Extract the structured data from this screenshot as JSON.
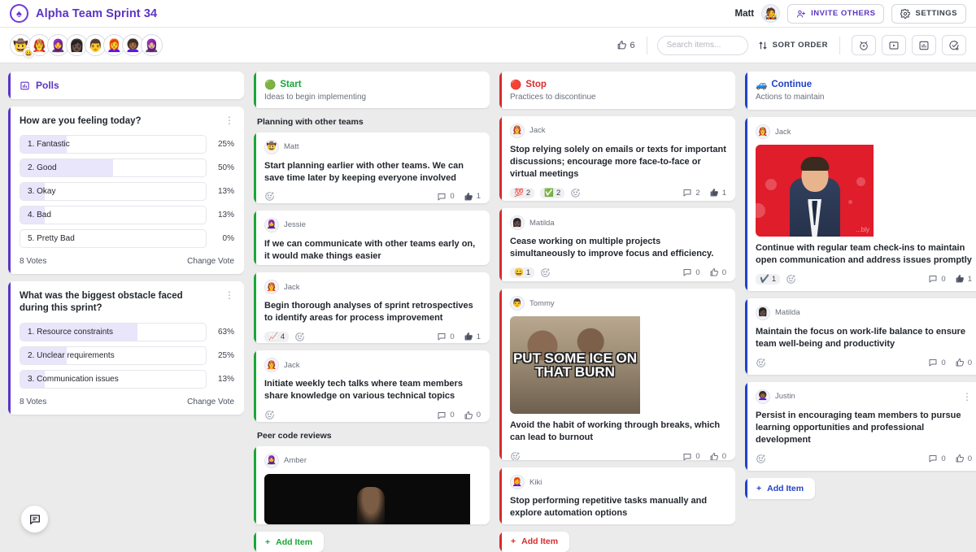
{
  "header": {
    "brand_title": "Alpha Team Sprint 34",
    "logo_icon": "spade-logo-icon",
    "user_name": "Matt",
    "user_avatar": "🧑‍🎤",
    "invite_label": "INVITE OTHERS",
    "settings_label": "SETTINGS"
  },
  "toolbar": {
    "participants": [
      "🤠",
      "👩‍🚒",
      "🧕",
      "👩🏿",
      "👨",
      "👩‍🦰",
      "👩🏾‍🦱",
      "🧕🏼"
    ],
    "participant_badge": "😀",
    "votes_count": "6",
    "search_placeholder": "Search items...",
    "search_value": "",
    "sort_label": "SORT ORDER",
    "icon_buttons": [
      "timer-icon",
      "present-icon",
      "poll-chart-icon",
      "checklist-icon"
    ]
  },
  "polls": {
    "panel_title": "Polls",
    "panel_icon": "poll-chart-icon",
    "accent": "#5b34c4",
    "items": [
      {
        "question": "How are you feeling today?",
        "options": [
          {
            "label": "1. Fantastic",
            "pct": "25%",
            "value": 25
          },
          {
            "label": "2. Good",
            "pct": "50%",
            "value": 50
          },
          {
            "label": "3. Okay",
            "pct": "13%",
            "value": 13
          },
          {
            "label": "4. Bad",
            "pct": "13%",
            "value": 13
          },
          {
            "label": "5. Pretty Bad",
            "pct": "0%",
            "value": 0
          }
        ],
        "votes": "8 Votes",
        "change_vote": "Change Vote"
      },
      {
        "question": "What was the biggest obstacle faced during this sprint?",
        "options": [
          {
            "label": "1. Resource constraints",
            "pct": "63%",
            "value": 63
          },
          {
            "label": "2. Unclear requirements",
            "pct": "25%",
            "value": 25
          },
          {
            "label": "3. Communication issues",
            "pct": "13%",
            "value": 13
          }
        ],
        "votes": "8 Votes",
        "change_vote": "Change Vote"
      }
    ]
  },
  "columns": [
    {
      "id": "start",
      "title": "Start",
      "emoji": "🟢",
      "subtitle": "Ideas to begin implementing",
      "color": "#1aa637",
      "add_label": "Add Item",
      "groups": [
        {
          "label": "Planning with other teams",
          "cards": [
            {
              "author": "Matt",
              "avatar": "🤠",
              "text": "Start planning earlier with other teams. We can save time later by keeping everyone involved",
              "reactions": [],
              "comments": "0",
              "likes": "1",
              "liked": true
            },
            {
              "author": "Jessie",
              "avatar": "🧕",
              "text": "If we can communicate with other teams early on, it would make things easier",
              "reactions": [],
              "comments": "",
              "likes": "",
              "liked": false
            },
            {
              "author": "Jack",
              "avatar": "👩‍🚒",
              "text": " Begin thorough analyses of sprint retrospectives to identify areas for process improvement",
              "reactions": [
                {
                  "emoji": "📈",
                  "count": "4"
                }
              ],
              "comments": "0",
              "likes": "1",
              "liked": true
            },
            {
              "author": "Jack",
              "avatar": "👩‍🚒",
              "text": "Initiate weekly tech talks where team members share knowledge on various technical topics",
              "reactions": [],
              "comments": "0",
              "likes": "0",
              "liked": false
            }
          ]
        },
        {
          "label": "Peer code reviews",
          "cards": [
            {
              "author": "Amber",
              "avatar": "🧕",
              "text": "",
              "media": "dark-photo",
              "reactions": [],
              "comments": "",
              "likes": "",
              "liked": false
            }
          ]
        }
      ]
    },
    {
      "id": "stop",
      "title": "Stop",
      "emoji": "🔴",
      "subtitle": "Practices to discontinue",
      "color": "#d92b2b",
      "add_label": "Add Item",
      "groups": [
        {
          "label": "",
          "cards": [
            {
              "author": "Jack",
              "avatar": "👩‍🚒",
              "text": "Stop relying solely on emails or texts for important discussions; encourage more face-to-face or virtual meetings",
              "reactions": [
                {
                  "emoji": "💯",
                  "count": "2"
                },
                {
                  "emoji": "✅",
                  "count": "2"
                }
              ],
              "comments": "2",
              "likes": "1",
              "liked": true
            },
            {
              "author": "Matilda",
              "avatar": "👩🏿",
              "text": "Cease working on multiple projects simultaneously to improve focus and efficiency.",
              "reactions": [
                {
                  "emoji": "😄",
                  "count": "1"
                }
              ],
              "comments": "0",
              "likes": "0",
              "liked": false
            },
            {
              "author": "Tommy",
              "avatar": "👨",
              "text": "Avoid the habit of working through breaks, which can lead to burnout",
              "media": "meme-ice",
              "media_text": "PUT SOME ICE ON THAT BURN",
              "reactions": [],
              "comments": "0",
              "likes": "0",
              "liked": false
            },
            {
              "author": "Kiki",
              "avatar": "👩‍🦰",
              "text": "Stop performing repetitive tasks manually and explore automation options",
              "reactions": [],
              "comments": "",
              "likes": "",
              "liked": false
            }
          ]
        }
      ]
    },
    {
      "id": "continue",
      "title": "Continue",
      "emoji": "🚙",
      "subtitle": "Actions to maintain",
      "color": "#2242c7",
      "add_label": "Add Item",
      "groups": [
        {
          "label": "",
          "cards": [
            {
              "author": "Jack",
              "avatar": "👩‍🚒",
              "text": "Continue with regular team check-ins to maintain open communication and address issues promptly",
              "media": "gif-red",
              "media_watermark": "...bly",
              "reactions": [
                {
                  "emoji": "✔️",
                  "count": "1"
                }
              ],
              "comments": "0",
              "likes": "1",
              "liked": true
            },
            {
              "author": "Matilda",
              "avatar": "👩🏿",
              "text": "Maintain the focus on work-life balance to ensure team well-being and productivity",
              "reactions": [],
              "comments": "0",
              "likes": "0",
              "liked": false
            },
            {
              "author": "Justin",
              "avatar": "👩🏾‍🦱",
              "text": "Persist in encouraging team members to pursue learning opportunities and professional development",
              "kebab": true,
              "reactions": [],
              "comments": "0",
              "likes": "0",
              "liked": false
            }
          ]
        }
      ]
    }
  ],
  "fab": {
    "icon": "chat-icon"
  }
}
